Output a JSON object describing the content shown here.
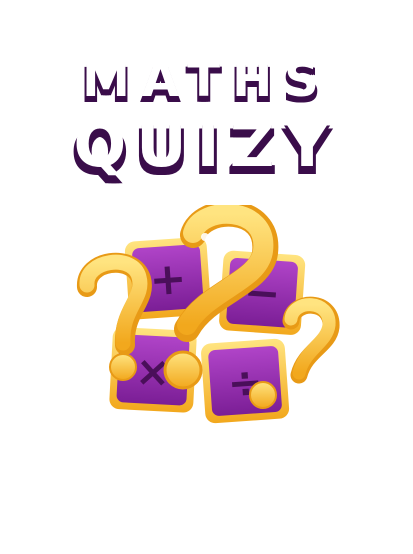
{
  "title": {
    "line1": "MATHS",
    "line2": "QUIZY"
  },
  "tiles": [
    {
      "symbol": "+",
      "name": "plus"
    },
    {
      "symbol": "−",
      "name": "minus"
    },
    {
      "symbol": "×",
      "name": "multiply"
    },
    {
      "symbol": "÷",
      "name": "divide"
    }
  ],
  "colors": {
    "tile_purple": "#8e2aa8",
    "tile_frame": "#f5c23c",
    "title_shadow": "#3a0d4a",
    "question_mark": "#ffc43a"
  }
}
